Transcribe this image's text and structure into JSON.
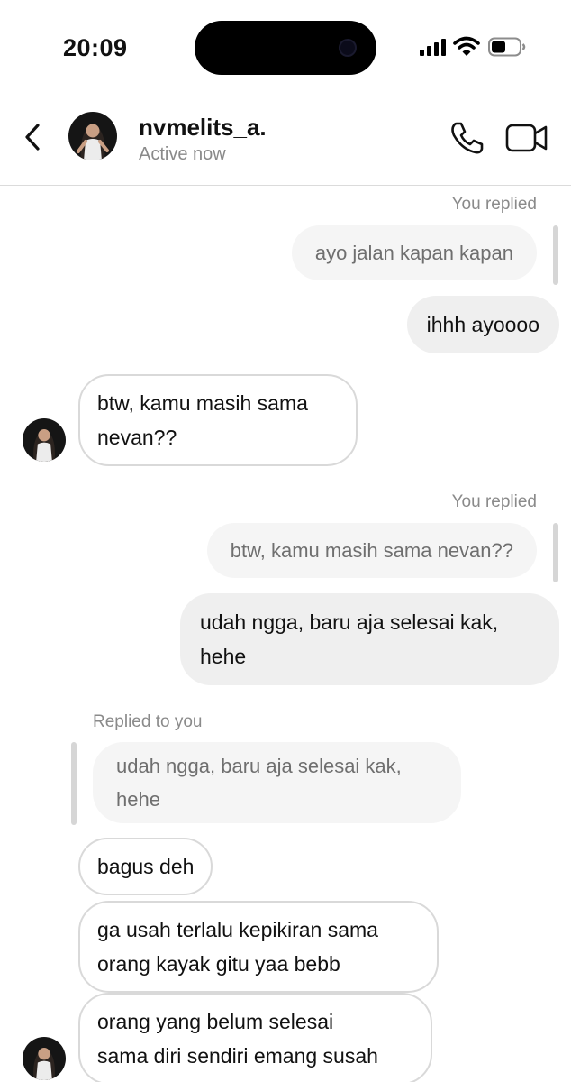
{
  "status_bar": {
    "time": "20:09",
    "icons": [
      "signal-icon",
      "wifi-icon",
      "battery-icon"
    ]
  },
  "header": {
    "contact_name": "nvmelits_a.",
    "status": "Active now",
    "icons": [
      "back-chevron-icon",
      "phone-icon",
      "video-camera-icon"
    ]
  },
  "messages": [
    {
      "type": "reply-label",
      "text": "You replied"
    },
    {
      "type": "quote",
      "text": "ayo jalan kapan kapan"
    },
    {
      "type": "outgoing",
      "text": "ihhh ayoooo"
    },
    {
      "type": "incoming",
      "lines": [
        "btw, kamu masih sama",
        "nevan??"
      ]
    },
    {
      "type": "reply-label",
      "text": "You replied"
    },
    {
      "type": "quote",
      "text": "btw, kamu masih sama nevan??"
    },
    {
      "type": "outgoing",
      "lines": [
        "udah ngga, baru aja selesai kak,",
        "hehe"
      ]
    },
    {
      "type": "reply-label",
      "text": "Replied to you"
    },
    {
      "type": "quote",
      "lines": [
        "udah ngga, baru aja selesai kak,",
        "hehe"
      ]
    },
    {
      "type": "incoming",
      "text": "bagus deh"
    },
    {
      "type": "incoming",
      "lines": [
        "ga usah terlalu kepikiran sama",
        "orang kayak gitu yaa bebb"
      ]
    },
    {
      "type": "incoming",
      "lines": [
        "orang yang belum selesai",
        "sama diri sendiri emang susah"
      ]
    }
  ],
  "colors": {
    "outgoing_bubble": "#efefef",
    "incoming_border": "#d9d9d9",
    "quote_bubble": "#f5f5f5",
    "muted_text": "#8a8a8a"
  }
}
